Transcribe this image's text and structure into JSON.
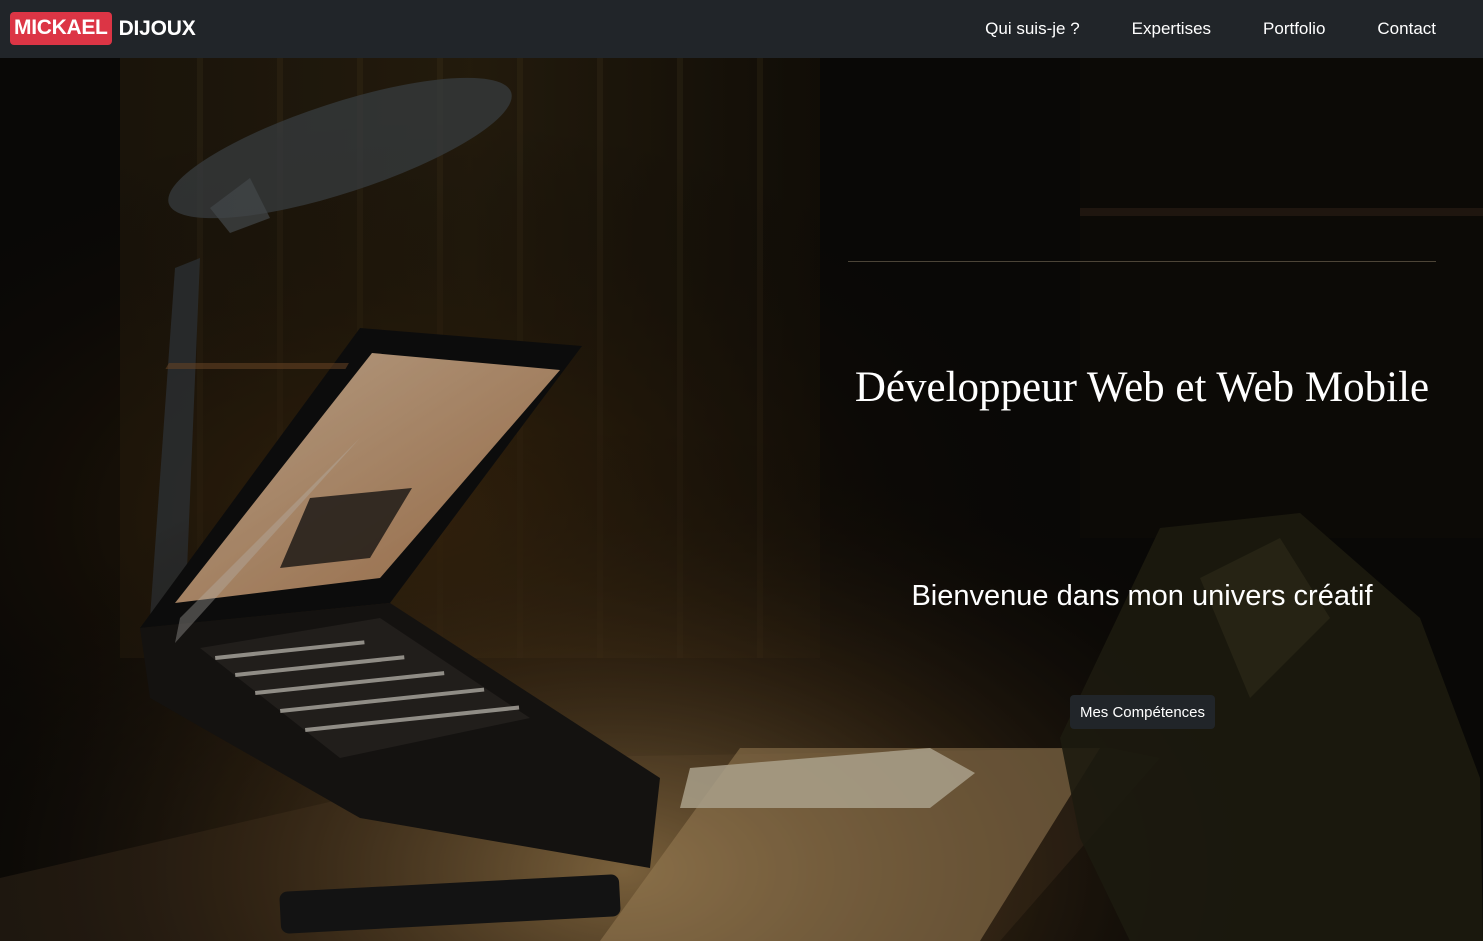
{
  "navbar": {
    "brand_first": "MICKAEL",
    "brand_last": "DIJOUX",
    "links": [
      "Qui suis-je ?",
      "Expertises",
      "Portfolio",
      "Contact"
    ]
  },
  "hero": {
    "title": "Développeur Web et Web Mobile",
    "subtitle": "Bienvenue dans mon univers créatif",
    "button_label": "Mes Compétences",
    "background_description_icon": "laptop-desk-night-photo"
  },
  "colors": {
    "navbar_bg": "#212529",
    "brand_accent": "#dc3545",
    "text": "#ffffff"
  }
}
